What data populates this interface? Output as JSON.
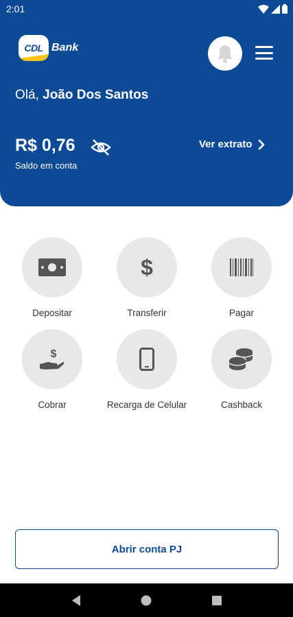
{
  "status_bar": {
    "time": "2:01"
  },
  "header": {
    "logo_badge": "CDL",
    "logo_text": "Bank",
    "greeting_prefix": "Olá, ",
    "user_name": "João Dos Santos",
    "balance": "R$ 0,76",
    "balance_label": "Saldo em conta",
    "statement_link": "Ver extrato"
  },
  "actions": [
    {
      "label": "Depositar",
      "icon": "cash-icon"
    },
    {
      "label": "Transferir",
      "icon": "dollar-icon"
    },
    {
      "label": "Pagar",
      "icon": "barcode-icon"
    },
    {
      "label": "Cobrar",
      "icon": "hand-dollar-icon"
    },
    {
      "label": "Recarga de Celular",
      "icon": "phone-icon"
    },
    {
      "label": "Cashback",
      "icon": "coins-icon"
    }
  ],
  "open_pj_button": "Abrir conta PJ",
  "colors": {
    "primary": "#0d4a96",
    "icon_circle": "#e8e8e8",
    "icon_color": "#555555"
  }
}
